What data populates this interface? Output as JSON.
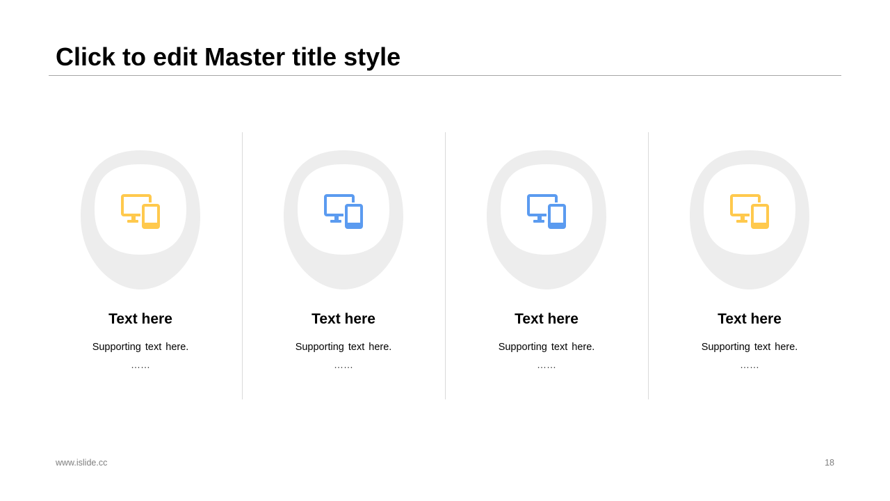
{
  "slide": {
    "title": "Click to edit Master title style"
  },
  "colors": {
    "yellow_accent": "#FFC94D",
    "blue_accent": "#5B9BF0",
    "badge_gray": "#EDEDED",
    "divider_gray": "#D9D9D9",
    "title_rule_gray": "#A6A6A6",
    "footer_gray": "#7F7F7F"
  },
  "cards": [
    {
      "icon": "desktop-tablet-icon",
      "icon_color": "#FFC94D",
      "heading": "Text here",
      "supporting": "Supporting text here.",
      "ellipsis": "……"
    },
    {
      "icon": "desktop-tablet-icon",
      "icon_color": "#5B9BF0",
      "heading": "Text here",
      "supporting": "Supporting text here.",
      "ellipsis": "……"
    },
    {
      "icon": "desktop-tablet-icon",
      "icon_color": "#5B9BF0",
      "heading": "Text here",
      "supporting": "Supporting text here.",
      "ellipsis": "……"
    },
    {
      "icon": "desktop-tablet-icon",
      "icon_color": "#FFC94D",
      "heading": "Text here",
      "supporting": "Supporting text here.",
      "ellipsis": "……"
    }
  ],
  "footer": {
    "url": "www.islide.cc",
    "page_number": "18"
  }
}
